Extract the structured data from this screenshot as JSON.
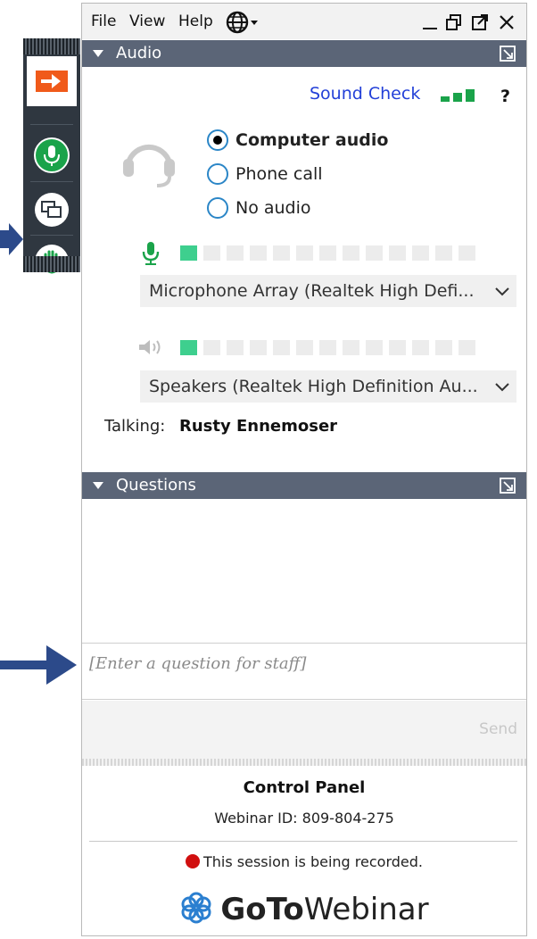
{
  "menu": {
    "file": "File",
    "view": "View",
    "help": "Help"
  },
  "icons": {
    "language": "globe-icon",
    "minimize": "minimize-icon",
    "restore": "restore-icon",
    "popout": "popout-icon",
    "close": "close-icon"
  },
  "toolbar": {
    "items": [
      {
        "icon": "arrow-right-icon",
        "color": "#f05a1a"
      },
      {
        "icon": "microphone-icon",
        "color": "#1aa34a"
      },
      {
        "icon": "screen-share-icon",
        "color": "#ffffff"
      },
      {
        "icon": "raise-hand-icon",
        "color": "#1aa34a"
      }
    ]
  },
  "audio": {
    "header": "Audio",
    "sound_check": "Sound Check",
    "help": "?",
    "options": [
      {
        "label": "Computer audio",
        "selected": true
      },
      {
        "label": "Phone call",
        "selected": false
      },
      {
        "label": "No audio",
        "selected": false
      }
    ],
    "microphone": {
      "device": "Microphone Array (Realtek High Defi...",
      "level_segments_on": 1,
      "segments_total": 13
    },
    "speakers": {
      "device": "Speakers (Realtek High Definition Au...",
      "level_segments_on": 1,
      "segments_total": 13
    },
    "talking_label": "Talking:",
    "talking_name": "Rusty Ennemoser"
  },
  "questions": {
    "header": "Questions",
    "input_placeholder": "[Enter a question for staff]",
    "send_label": "Send"
  },
  "footer": {
    "control_panel": "Control Panel",
    "webinar_id": "Webinar ID: 809-804-275",
    "recording": "This session is being recorded.",
    "brand_go": "GoTo",
    "brand_rest": "Webinar"
  },
  "colors": {
    "header_bg": "#5b6577",
    "accent_blue": "#2340d8",
    "signal_green": "#1aa34a",
    "meter_green": "#3ecf8e",
    "pointer_arrow": "#2c4a8a",
    "record_red": "#d10f0f"
  }
}
